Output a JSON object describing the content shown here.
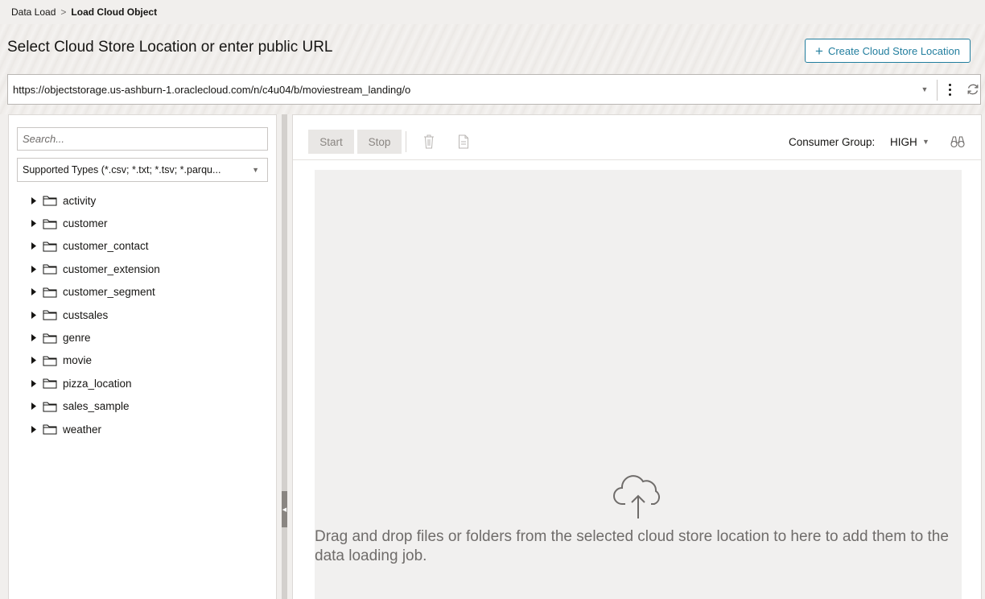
{
  "breadcrumb": {
    "parent": "Data Load",
    "separator": ">",
    "current": "Load Cloud Object"
  },
  "header": {
    "title": "Select Cloud Store Location or enter public URL",
    "create_button": "Create Cloud Store Location"
  },
  "url_bar": {
    "value": "https://objectstorage.us-ashburn-1.oraclecloud.com/n/c4u04/b/moviestream_landing/o"
  },
  "left_panel": {
    "search_placeholder": "Search...",
    "type_filter": "Supported Types (*.csv; *.txt; *.tsv; *.parqu...",
    "folders": [
      "activity",
      "customer",
      "customer_contact",
      "customer_extension",
      "customer_segment",
      "custsales",
      "genre",
      "movie",
      "pizza_location",
      "sales_sample",
      "weather"
    ]
  },
  "toolbar": {
    "start_label": "Start",
    "stop_label": "Stop",
    "consumer_group_label": "Consumer Group:",
    "consumer_group_value": "HIGH"
  },
  "drop_zone": {
    "text": "Drag and drop files or folders from the selected cloud store location to here to add them to the data loading job."
  },
  "colors": {
    "accent": "#227e9e",
    "background": "#f1efed",
    "drop_zone": "#f1f0ef"
  }
}
